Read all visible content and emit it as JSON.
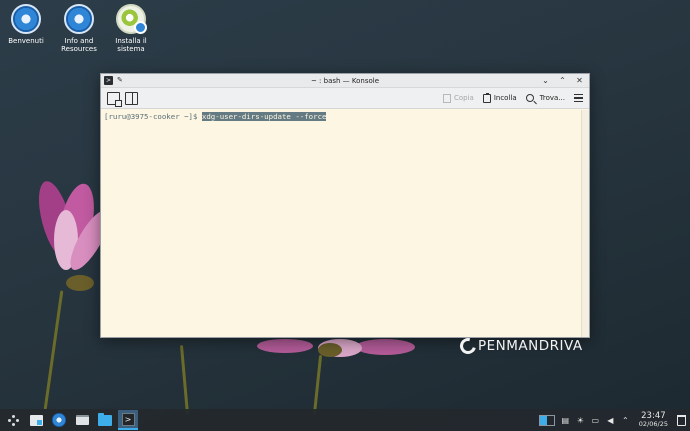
{
  "desktop": {
    "icons": [
      {
        "label": "Benvenuti",
        "icon": "openmandriva-welcome-icon"
      },
      {
        "label": "Info and Resources",
        "icon": "openmandriva-info-icon"
      },
      {
        "label": "Installa il sistema",
        "icon": "installer-icon"
      }
    ],
    "logo_text": "PENMANDRIVA"
  },
  "window": {
    "title": "~ : bash — Konsole",
    "toolbar": {
      "copy_label": "Copia",
      "paste_label": "Incolla",
      "find_label": "Trova..."
    },
    "terminal": {
      "prompt": "[ruru@3975-cooker ~]$ ",
      "command": "xdg-user-dirs-update --force"
    },
    "colors": {
      "background": "#fdf6e3",
      "foreground": "#586e75",
      "selection": "#657b83"
    }
  },
  "taskbar": {
    "clock_time": "23:47",
    "clock_date": "02/06/25",
    "accent": "#3daee9"
  }
}
